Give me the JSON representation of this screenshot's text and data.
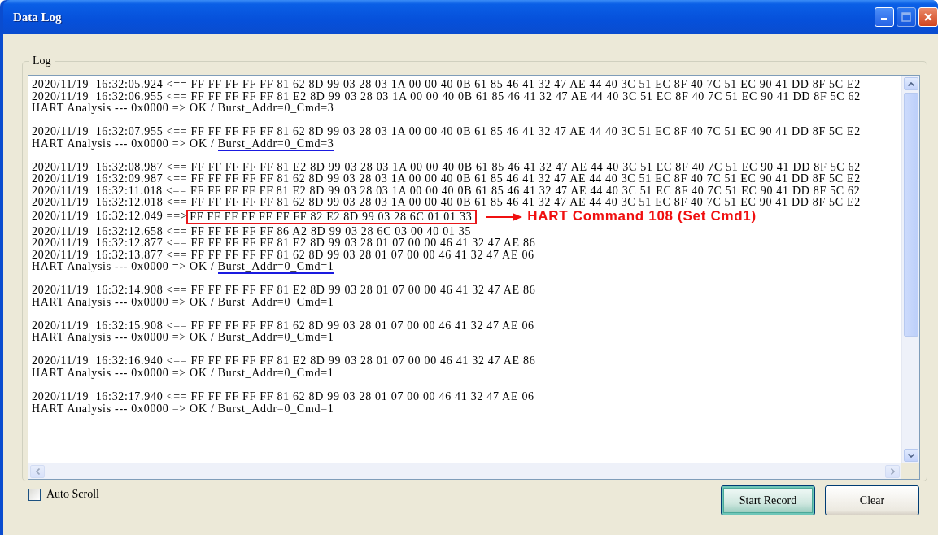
{
  "window": {
    "title": "Data Log"
  },
  "log": {
    "label": "Log",
    "groups": [
      {
        "lines": [
          {
            "text": "2020/11/19  16:32:05.924 <== FF FF FF FF FF 81 62 8D 99 03 28 03 1A 00 00 40 0B 61 85 46 41 32 47 AE 44 40 3C 51 EC 8F 40 7C 51 EC 90 41 DD 8F 5C E2"
          },
          {
            "text": "2020/11/19  16:32:06.955 <== FF FF FF FF FF 81 E2 8D 99 03 28 03 1A 00 00 40 0B 61 85 46 41 32 47 AE 44 40 3C 51 EC 8F 40 7C 51 EC 90 41 DD 8F 5C 62"
          },
          {
            "text": "HART Analysis --- 0x0000 => OK / Burst_Addr=0_Cmd=3"
          }
        ]
      },
      {
        "lines": [
          {
            "text": "2020/11/19  16:32:07.955 <== FF FF FF FF FF 81 62 8D 99 03 28 03 1A 00 00 40 0B 61 85 46 41 32 47 AE 44 40 3C 51 EC 8F 40 7C 51 EC 90 41 DD 8F 5C E2"
          },
          {
            "text": "HART Analysis --- 0x0000 => OK / ",
            "underlined": "Burst_Addr=0_Cmd=3"
          }
        ]
      },
      {
        "lines": [
          {
            "text": "2020/11/19  16:32:08.987 <== FF FF FF FF FF 81 E2 8D 99 03 28 03 1A 00 00 40 0B 61 85 46 41 32 47 AE 44 40 3C 51 EC 8F 40 7C 51 EC 90 41 DD 8F 5C 62"
          },
          {
            "text": "2020/11/19  16:32:09.987 <== FF FF FF FF FF 81 62 8D 99 03 28 03 1A 00 00 40 0B 61 85 46 41 32 47 AE 44 40 3C 51 EC 8F 40 7C 51 EC 90 41 DD 8F 5C E2"
          },
          {
            "text": "2020/11/19  16:32:11.018 <== FF FF FF FF FF 81 E2 8D 99 03 28 03 1A 00 00 40 0B 61 85 46 41 32 47 AE 44 40 3C 51 EC 8F 40 7C 51 EC 90 41 DD 8F 5C 62"
          },
          {
            "text": "2020/11/19  16:32:12.018 <== FF FF FF FF FF 81 62 8D 99 03 28 03 1A 00 00 40 0B 61 85 46 41 32 47 AE 44 40 3C 51 EC 8F 40 7C 51 EC 90 41 DD 8F 5C E2"
          },
          {
            "text": "2020/11/19  16:32:12.049 ==>",
            "boxed": "FF FF FF FF FF FF FF 82 E2 8D 99 03 28 6C 01 01 33",
            "callout": "HART Command 108 (Set Cmd1)"
          },
          {
            "text": "2020/11/19  16:32:12.658 <== FF FF FF FF FF 86 A2 8D 99 03 28 6C 03 00 40 01 35"
          },
          {
            "text": "2020/11/19  16:32:12.877 <== FF FF FF FF FF 81 E2 8D 99 03 28 01 07 00 00 46 41 32 47 AE 86"
          },
          {
            "text": "2020/11/19  16:32:13.877 <== FF FF FF FF FF 81 62 8D 99 03 28 01 07 00 00 46 41 32 47 AE 06"
          },
          {
            "text": "HART Analysis --- 0x0000 => OK / ",
            "underlined": "Burst_Addr=0_Cmd=1"
          }
        ]
      },
      {
        "lines": [
          {
            "text": "2020/11/19  16:32:14.908 <== FF FF FF FF FF 81 E2 8D 99 03 28 01 07 00 00 46 41 32 47 AE 86"
          },
          {
            "text": "HART Analysis --- 0x0000 => OK / Burst_Addr=0_Cmd=1"
          }
        ]
      },
      {
        "lines": [
          {
            "text": "2020/11/19  16:32:15.908 <== FF FF FF FF FF 81 62 8D 99 03 28 01 07 00 00 46 41 32 47 AE 06"
          },
          {
            "text": "HART Analysis --- 0x0000 => OK / Burst_Addr=0_Cmd=1"
          }
        ]
      },
      {
        "lines": [
          {
            "text": "2020/11/19  16:32:16.940 <== FF FF FF FF FF 81 E2 8D 99 03 28 01 07 00 00 46 41 32 47 AE 86"
          },
          {
            "text": "HART Analysis --- 0x0000 => OK / Burst_Addr=0_Cmd=1"
          }
        ]
      },
      {
        "lines": [
          {
            "text": "2020/11/19  16:32:17.940 <== FF FF FF FF FF 81 62 8D 99 03 28 01 07 00 00 46 41 32 47 AE 06"
          },
          {
            "text": "HART Analysis --- 0x0000 => OK / Burst_Addr=0_Cmd=1"
          }
        ]
      }
    ]
  },
  "auto_scroll": {
    "label": "Auto Scroll",
    "checked": false
  },
  "buttons": [
    {
      "label": "Start Record",
      "default": true
    },
    {
      "label": "Clear",
      "default": false
    }
  ]
}
